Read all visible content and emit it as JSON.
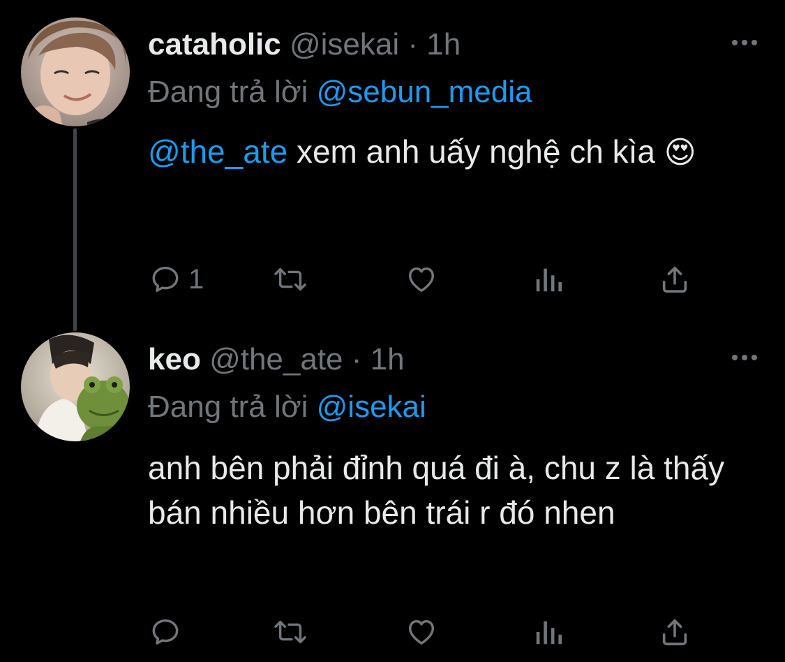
{
  "tweets": [
    {
      "display_name": "cataholic",
      "handle": "@isekai",
      "separator": "·",
      "time": "1h",
      "reply_prefix": "Đang trả lời",
      "reply_to": "@sebun_media",
      "body_mention": "@the_ate",
      "body_text": " xem anh uấy nghệ ch kìa",
      "emoji": "😍",
      "reply_count": "1",
      "avatar_icon": "person-photo"
    },
    {
      "display_name": "keo",
      "handle": "@the_ate",
      "separator": "·",
      "time": "1h",
      "reply_prefix": "Đang trả lời",
      "reply_to": "@isekai",
      "body_text": "anh bên phải đỉnh quá đi à, chu z là thấy bán nhiều hơn bên trái r đó nhen",
      "reply_count": "",
      "avatar_icon": "person-with-frog-plush-photo"
    }
  ],
  "icons": {
    "reply": "reply-icon",
    "retweet": "retweet-icon",
    "like": "heart-icon",
    "analytics": "analytics-icon",
    "share": "share-icon",
    "more": "more-icon"
  },
  "colors": {
    "background": "#000000",
    "text": "#e7e9ea",
    "muted": "#71767b",
    "link": "#1d9bf0",
    "thread_line": "#3f4448"
  }
}
